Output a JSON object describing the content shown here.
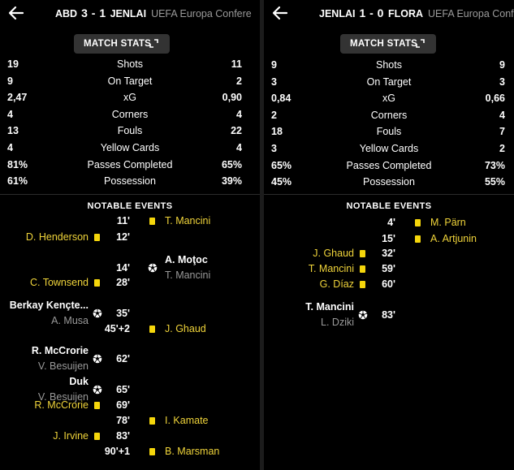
{
  "matches": [
    {
      "home_abbr": "ABD",
      "score": "3 - 1",
      "away_abbr": "JENLAI",
      "competition": "UEFA Europa Confere",
      "stats_button_label": "MATCH STATS",
      "events_title": "NOTABLE EVENTS",
      "stats": [
        {
          "label": "Shots",
          "home": "19",
          "away": "11"
        },
        {
          "label": "On Target",
          "home": "9",
          "away": "2"
        },
        {
          "label": "xG",
          "home": "2,47",
          "away": "0,90"
        },
        {
          "label": "Corners",
          "home": "4",
          "away": "4"
        },
        {
          "label": "Fouls",
          "home": "13",
          "away": "22"
        },
        {
          "label": "Yellow Cards",
          "home": "4",
          "away": "4"
        },
        {
          "label": "Passes Completed",
          "home": "81%",
          "away": "65%"
        },
        {
          "label": "Possession",
          "home": "61%",
          "away": "39%"
        }
      ],
      "events": [
        {
          "minute": "11'",
          "side": "away",
          "type": "yellow",
          "player": "T. Mancini"
        },
        {
          "minute": "12'",
          "side": "home",
          "type": "yellow",
          "player": "D. Henderson"
        },
        {
          "minute": "14'",
          "side": "away",
          "type": "goal",
          "player": "A. Moţoc",
          "assist": "T. Mancini"
        },
        {
          "minute": "28'",
          "side": "home",
          "type": "yellow",
          "player": "C. Townsend"
        },
        {
          "minute": "35'",
          "side": "home",
          "type": "goal",
          "player": "Berkay Kençte...",
          "assist": "A. Musa"
        },
        {
          "minute": "45'+2",
          "side": "away",
          "type": "yellow",
          "player": "J. Ghaud"
        },
        {
          "minute": "62'",
          "side": "home",
          "type": "goal",
          "player": "R. McCrorie",
          "assist": "V. Besuijen"
        },
        {
          "minute": "65'",
          "side": "home",
          "type": "goal",
          "player": "Duk",
          "assist": "V. Besuijen"
        },
        {
          "minute": "69'",
          "side": "home",
          "type": "yellow",
          "player": "R. McCrorie"
        },
        {
          "minute": "78'",
          "side": "away",
          "type": "yellow",
          "player": "I. Kamate"
        },
        {
          "minute": "83'",
          "side": "home",
          "type": "yellow",
          "player": "J. Irvine"
        },
        {
          "minute": "90'+1",
          "side": "away",
          "type": "yellow",
          "player": "B. Marsman"
        }
      ]
    },
    {
      "home_abbr": "JENLAI",
      "score": "1 - 0",
      "away_abbr": "FLORA",
      "competition": "UEFA Europa Conf",
      "stats_button_label": "MATCH STATS",
      "events_title": "NOTABLE EVENTS",
      "stats": [
        {
          "label": "Shots",
          "home": "9",
          "away": "9"
        },
        {
          "label": "On Target",
          "home": "3",
          "away": "3"
        },
        {
          "label": "xG",
          "home": "0,84",
          "away": "0,66"
        },
        {
          "label": "Corners",
          "home": "2",
          "away": "4"
        },
        {
          "label": "Fouls",
          "home": "18",
          "away": "7"
        },
        {
          "label": "Yellow Cards",
          "home": "3",
          "away": "2"
        },
        {
          "label": "Passes Completed",
          "home": "65%",
          "away": "73%"
        },
        {
          "label": "Possession",
          "home": "45%",
          "away": "55%"
        }
      ],
      "events": [
        {
          "minute": "4'",
          "side": "away",
          "type": "yellow",
          "player": "M. Pärn"
        },
        {
          "minute": "15'",
          "side": "away",
          "type": "yellow",
          "player": "A. Artjunin"
        },
        {
          "minute": "32'",
          "side": "home",
          "type": "yellow",
          "player": "J. Ghaud"
        },
        {
          "minute": "59'",
          "side": "home",
          "type": "yellow",
          "player": "T. Mancini"
        },
        {
          "minute": "60'",
          "side": "home",
          "type": "yellow",
          "player": "G. Díaz"
        },
        {
          "minute": "83'",
          "side": "home",
          "type": "goal",
          "player": "T. Mancini",
          "assist": "L. Dziki"
        }
      ]
    }
  ],
  "colors": {
    "card_yellow": "#f5d60b",
    "name_yellow": "#f0d43a",
    "muted": "#9a9a9a",
    "button_bg": "#333333"
  },
  "icons": {
    "back": "back-arrow-icon",
    "expand": "expand-icon",
    "card": "yellow-card-icon",
    "goal": "ball-icon"
  }
}
